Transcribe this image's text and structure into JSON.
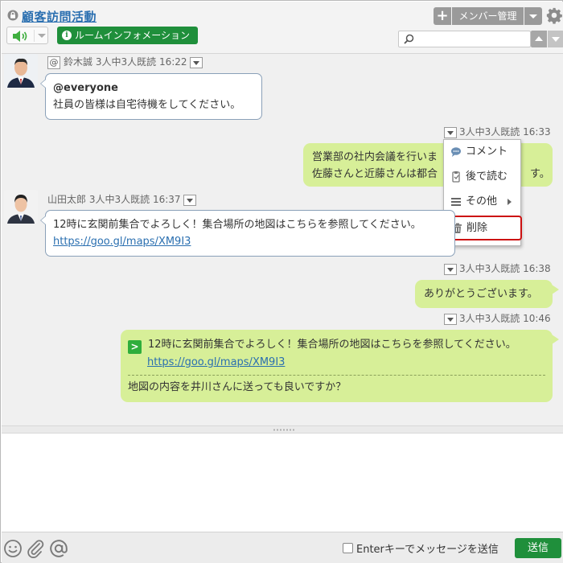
{
  "header": {
    "room_title": "顧客訪問活動",
    "room_info_label": "ルームインフォメーション",
    "member_label": "メンバー管理",
    "search_value": "",
    "search_placeholder": ""
  },
  "messages": [
    {
      "id": "m1",
      "side": "left",
      "sender": "鈴木誠",
      "read": "3人中3人既読",
      "time": "16:22",
      "mention_mark": "@",
      "lines": [
        "@everyone",
        "社員の皆様は自宅待機をしてください。"
      ]
    },
    {
      "id": "m2",
      "side": "right",
      "read": "3人中3人既読",
      "time": "16:33",
      "lines": [
        "営業部の社内会議を行いま",
        "佐藤さんと近藤さんは都合",
        "す。"
      ]
    },
    {
      "id": "m3",
      "side": "left",
      "sender": "山田太郎",
      "read": "3人中3人既読",
      "time": "16:37",
      "lines": [
        "12時に玄関前集合でよろしく！集合場所の地図はこちらを参照してください。",
        "https://goo.gl/maps/XM9I3"
      ]
    },
    {
      "id": "m4",
      "side": "right",
      "read": "3人中3人既読",
      "time": "16:38",
      "lines": [
        "ありがとうございます。"
      ]
    },
    {
      "id": "m5",
      "side": "right",
      "read": "3人中3人既読",
      "time": "10:46",
      "quote_mark": ">",
      "quote_lines": [
        "12時に玄関前集合でよろしく！集合場所の地図はこちらを参照してください。",
        "https://goo.gl/maps/XM9I3"
      ],
      "lines": [
        "地図の内容を井川さんに送っても良いですか？"
      ]
    }
  ],
  "context_menu": {
    "items": [
      {
        "label": "コメント",
        "icon": "comment-icon"
      },
      {
        "label": "後で読む",
        "icon": "read-later-icon"
      },
      {
        "label": "その他",
        "icon": "more-list-icon"
      },
      {
        "label": "削除",
        "icon": "trash-icon"
      }
    ]
  },
  "composer": {
    "value": "",
    "placeholder": "",
    "enter_to_send_label": "Enterキーでメッセージを送信",
    "send_label": "送信"
  },
  "colors": {
    "accent_green": "#1f8f3b",
    "link_blue": "#2a6fb0",
    "own_bubble": "#d7ef98",
    "delete_highlight": "#cc1111"
  }
}
